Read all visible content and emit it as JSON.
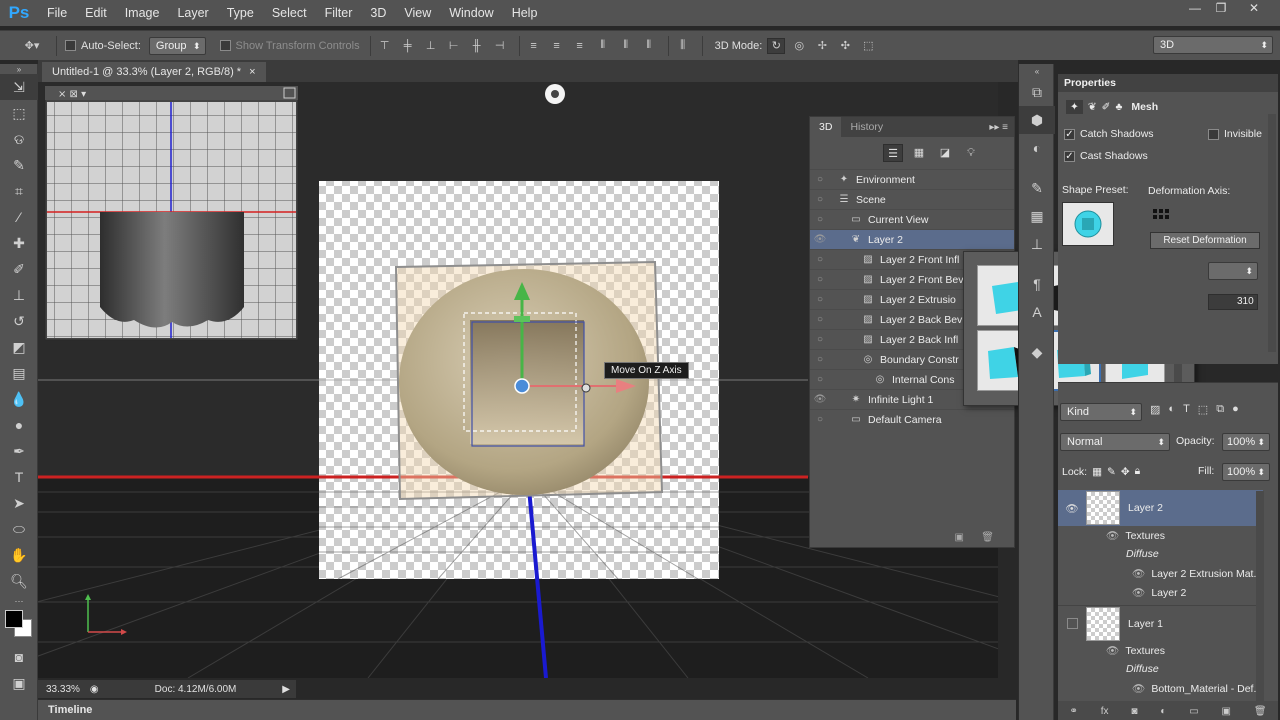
{
  "app": {
    "logo": "Ps",
    "menu": [
      "File",
      "Edit",
      "Image",
      "Layer",
      "Type",
      "Select",
      "Filter",
      "3D",
      "View",
      "Window",
      "Help"
    ]
  },
  "options": {
    "auto_select_label": "Auto-Select:",
    "auto_select_value": "Group",
    "show_transform_label": "Show Transform Controls",
    "mode_label": "3D Mode:",
    "workspace": "3D"
  },
  "document": {
    "tab_title": "Untitled-1 @ 33.3% (Layer 2, RGB/8) *",
    "zoom": "33.33%",
    "doc_size": "Doc: 4.12M/6.00M",
    "tooltip": "Move On Z Axis"
  },
  "timeline": {
    "label": "Timeline"
  },
  "panel3d": {
    "tabs": [
      "3D",
      "History"
    ],
    "items": [
      {
        "label": "Environment",
        "indent": 0,
        "eye": false
      },
      {
        "label": "Scene",
        "indent": 0,
        "eye": false
      },
      {
        "label": "Current View",
        "indent": 1,
        "eye": false
      },
      {
        "label": "Layer 2",
        "indent": 1,
        "eye": true,
        "selected": true
      },
      {
        "label": "Layer 2 Front Infl",
        "indent": 2,
        "eye": false
      },
      {
        "label": "Layer 2 Front Bev",
        "indent": 2,
        "eye": false
      },
      {
        "label": "Layer 2 Extrusio",
        "indent": 2,
        "eye": false
      },
      {
        "label": "Layer 2 Back Bev",
        "indent": 2,
        "eye": false
      },
      {
        "label": "Layer 2 Back Infl",
        "indent": 2,
        "eye": false
      },
      {
        "label": "Boundary Constr",
        "indent": 2,
        "eye": false
      },
      {
        "label": "Internal Cons",
        "indent": 3,
        "eye": false
      },
      {
        "label": "Infinite Light 1",
        "indent": 1,
        "eye": true
      },
      {
        "label": "Default Camera",
        "indent": 1,
        "eye": false
      }
    ]
  },
  "properties": {
    "title": "Properties",
    "mode": "Mesh",
    "catch_shadows": "Catch Shadows",
    "cast_shadows": "Cast Shadows",
    "invisible": "Invisible",
    "shape_preset": "Shape Preset:",
    "deformation_axis": "Deformation Axis:",
    "reset_deformation": "Reset Deformation",
    "value": "310"
  },
  "layers": {
    "kind": "Kind",
    "blend": "Normal",
    "opacity_label": "Opacity:",
    "opacity": "100%",
    "lock_label": "Lock:",
    "fill_label": "Fill:",
    "fill": "100%",
    "items": [
      {
        "name": "Layer 2",
        "textures": "Textures",
        "diffuse": "Diffuse",
        "sub": [
          "Layer 2 Extrusion Mat...",
          "Layer 2"
        ]
      },
      {
        "name": "Layer 1",
        "textures": "Textures",
        "diffuse": "Diffuse",
        "sub": [
          "Bottom_Material - Def..."
        ]
      }
    ]
  }
}
